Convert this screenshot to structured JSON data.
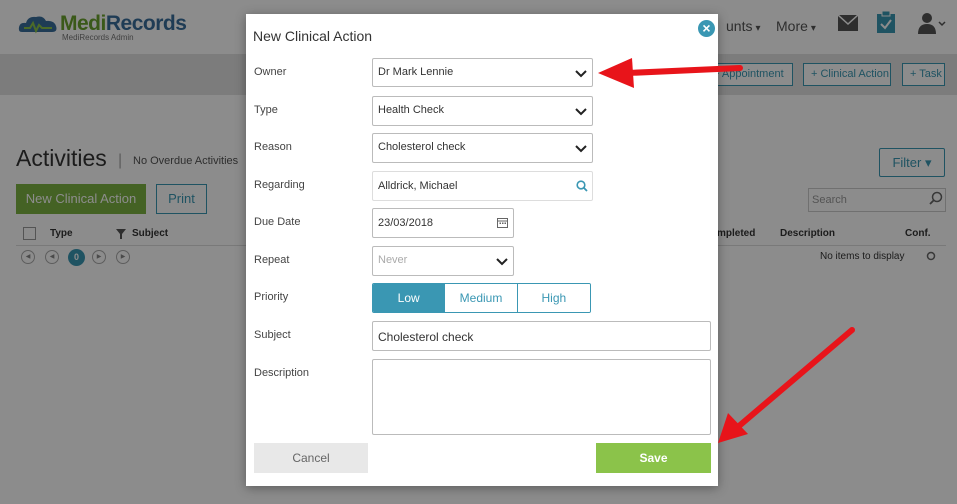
{
  "app": {
    "brand_medi": "Medi",
    "brand_records": "Records",
    "brand_sub": "MediRecords Admin",
    "nav": {
      "accounts_partial": "unts",
      "more": "More"
    }
  },
  "toolbar": {
    "appointment": "+ Appointment",
    "clinical_action": "+ Clinical Action",
    "task": "+ Task"
  },
  "page": {
    "title": "Activities",
    "separator": "|",
    "overdue": "No Overdue Activities",
    "filter": "Filter",
    "new_button": "New Clinical Action",
    "print_button": "Print",
    "search_placeholder": "Search",
    "grid_columns": {
      "type": "Type",
      "subject": "Subject",
      "completed_partial": "mpleted",
      "description": "Description",
      "conf": "Conf."
    },
    "pager_current": "0",
    "no_items": "No items to display"
  },
  "dialog": {
    "title": "New Clinical Action",
    "close_glyph": "×",
    "labels": {
      "owner": "Owner",
      "type": "Type",
      "reason": "Reason",
      "regarding": "Regarding",
      "due_date": "Due Date",
      "repeat": "Repeat",
      "priority": "Priority",
      "subject": "Subject",
      "description": "Description"
    },
    "values": {
      "owner": "Dr Mark Lennie",
      "type": "Health Check",
      "reason": "Cholesterol check",
      "regarding": "Alldrick, Michael",
      "due_date": "23/03/2018",
      "repeat": "Never",
      "subject": "Cholesterol check",
      "description": ""
    },
    "priority_options": [
      "Low",
      "Medium",
      "High"
    ],
    "priority_selected": "Low",
    "cancel": "Cancel",
    "save": "Save"
  },
  "colors": {
    "accent": "#3a97b3",
    "save_green": "#8bc34a",
    "annotation_arrow": "#e8141a"
  }
}
